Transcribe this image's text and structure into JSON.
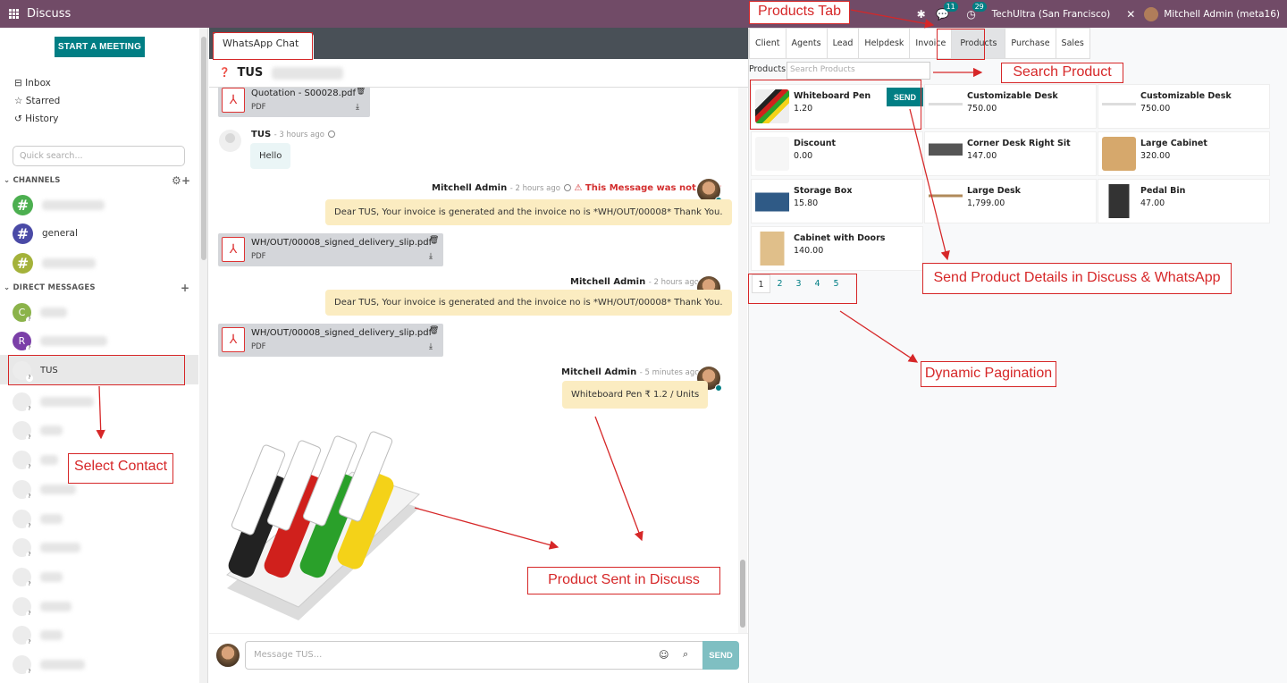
{
  "topbar": {
    "app_title": "Discuss",
    "badge_chat": "11",
    "badge_activity": "29",
    "company": "TechUltra (San Francisco)",
    "user": "Mitchell Admin (meta16)"
  },
  "sidebar": {
    "start_meeting": "START A MEETING",
    "nav": [
      {
        "label": "Inbox",
        "icon": "inbox-icon"
      },
      {
        "label": "Starred",
        "icon": "star-icon"
      },
      {
        "label": "History",
        "icon": "history-icon"
      }
    ],
    "quick_search_placeholder": "Quick search...",
    "channels_title": "CHANNELS",
    "channel_general": "general",
    "dm_title": "DIRECT MESSAGES",
    "dm_initials": [
      "C",
      "R"
    ],
    "dm_selected": "TUS"
  },
  "chat": {
    "tab": "WhatsApp Chat",
    "header_name": "TUS",
    "att1": {
      "name": "Quotation - S00028.pdf",
      "type": "PDF"
    },
    "msg_hello": {
      "author": "TUS",
      "time": "- 3 hours ago",
      "text": "Hello"
    },
    "msg_invoice1": {
      "author": "Mitchell Admin",
      "time": "- 2 hours ago",
      "error": "This Message was not sent",
      "text": "Dear TUS, Your invoice is generated and the invoice no is *WH/OUT/00008* Thank You."
    },
    "att2": {
      "name": "WH/OUT/00008_signed_delivery_slip.pdf",
      "type": "PDF"
    },
    "msg_invoice2": {
      "author": "Mitchell Admin",
      "time": "- 2 hours ago",
      "text": "Dear TUS, Your invoice is generated and the invoice no is *WH/OUT/00008* Thank You."
    },
    "att3": {
      "name": "WH/OUT/00008_signed_delivery_slip.pdf",
      "type": "PDF"
    },
    "msg_product": {
      "author": "Mitchell Admin",
      "time": "- 5 minutes ago",
      "text": "Whiteboard Pen ₹ 1.2 / Units"
    },
    "composer_placeholder": "Message TUS...",
    "send": "SEND"
  },
  "products": {
    "tabs": [
      "Client",
      "Agents",
      "Lead",
      "Helpdesk",
      "Invoice",
      "Products",
      "Purchase",
      "Sales"
    ],
    "active_tab": "Products",
    "label": "Products",
    "search_placeholder": "Search Products",
    "send_label": "SEND",
    "items": [
      {
        "name": "Whiteboard Pen",
        "price": "1.20"
      },
      {
        "name": "Customizable Desk",
        "price": "750.00"
      },
      {
        "name": "Customizable Desk",
        "price": "750.00"
      },
      {
        "name": "Discount",
        "price": "0.00"
      },
      {
        "name": "Corner Desk Right Sit",
        "price": "147.00"
      },
      {
        "name": "Large Cabinet",
        "price": "320.00"
      },
      {
        "name": "Storage Box",
        "price": "15.80"
      },
      {
        "name": "Large Desk",
        "price": "1,799.00"
      },
      {
        "name": "Pedal Bin",
        "price": "47.00"
      },
      {
        "name": "Cabinet with Doors",
        "price": "140.00"
      }
    ],
    "pages": [
      "1",
      "2",
      "3",
      "4",
      "5"
    ]
  },
  "annotations": {
    "products_tab": "Products Tab",
    "search_product": "Search Product",
    "send_details": "Send Product Details in Discuss & WhatsApp",
    "pagination": "Dynamic Pagination",
    "select_contact": "Select Contact",
    "product_sent": "Product Sent in Discuss"
  }
}
